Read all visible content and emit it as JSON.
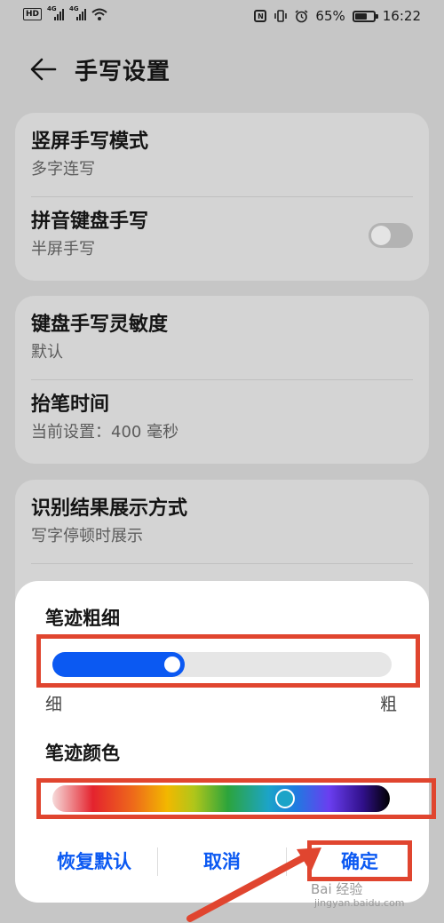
{
  "status_bar": {
    "hd": "HD",
    "nfc": "N",
    "battery": "65%",
    "battery_level": 0.65,
    "time": "16:22"
  },
  "header": {
    "title": "手写设置"
  },
  "card1": {
    "items": [
      {
        "title": "竖屏手写模式",
        "subtitle": "多字连写"
      },
      {
        "title": "拼音键盘手写",
        "subtitle": "半屏手写",
        "toggle_on": false
      }
    ]
  },
  "card2": {
    "items": [
      {
        "title": "键盘手写灵敏度",
        "subtitle": "默认"
      },
      {
        "title": "抬笔时间",
        "subtitle": "当前设置：400 毫秒"
      }
    ]
  },
  "card3": {
    "items": [
      {
        "title": "识别结果展示方式",
        "subtitle": "写字停顿时展示"
      }
    ]
  },
  "sheet": {
    "thickness_label": "笔迹粗细",
    "thickness_value": 0.39,
    "thin_label": "细",
    "thick_label": "粗",
    "color_label": "笔迹颜色",
    "color_value": 0.69,
    "selected_color": "#1ca4c8",
    "accent": "#0b59f2",
    "restore_label": "恢复默认",
    "cancel_label": "取消",
    "confirm_label": "确定"
  },
  "annotation": {
    "color": "#e0452f"
  },
  "watermark": {
    "text": "Bai 经验",
    "sub": "jingyan.baidu.com"
  }
}
